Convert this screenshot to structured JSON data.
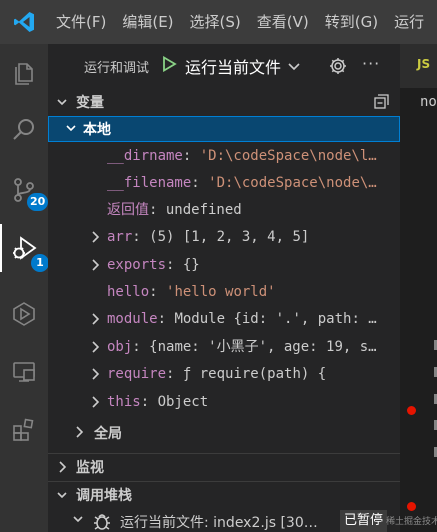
{
  "menu": [
    "文件(F)",
    "编辑(E)",
    "选择(S)",
    "查看(V)",
    "转到(G)",
    "运行"
  ],
  "activity_bar": {
    "items": [
      {
        "name": "explorer-icon"
      },
      {
        "name": "search-icon"
      },
      {
        "name": "source-control-icon",
        "badge": "20"
      },
      {
        "name": "run-debug-icon",
        "badge": "1",
        "active": true
      },
      {
        "name": "extensions-test-icon"
      },
      {
        "name": "remote-explorer-icon"
      },
      {
        "name": "extensions-icon"
      }
    ]
  },
  "debug_toolbar": {
    "title": "运行和调试",
    "config_label": "运行当前文件",
    "more_label": "···"
  },
  "sections": {
    "variables": "变量",
    "watch": "监视",
    "call_stack": "调用堆栈"
  },
  "scopes": {
    "local": "本地",
    "global": "全局"
  },
  "variables": [
    {
      "name": "__dirname",
      "value": "'D:\\codeSpace\\node\\l…",
      "kind": "string",
      "expandable": false
    },
    {
      "name": "__filename",
      "value": "'D:\\codeSpace\\node\\…",
      "kind": "string",
      "expandable": false
    },
    {
      "name": "返回值",
      "value": "undefined",
      "kind": "plain",
      "expandable": false,
      "label_is_text": true
    },
    {
      "name": "arr",
      "value": "(5) [1, 2, 3, 4, 5]",
      "kind": "plain",
      "expandable": true
    },
    {
      "name": "exports",
      "value": "{}",
      "kind": "plain",
      "expandable": true
    },
    {
      "name": "hello",
      "value": "'hello world'",
      "kind": "string",
      "expandable": false
    },
    {
      "name": "module",
      "value": "Module {id: '.', path: …",
      "kind": "plain",
      "expandable": true
    },
    {
      "name": "obj",
      "value": "{name: '小黑子', age: 19, s…",
      "kind": "plain",
      "expandable": true
    },
    {
      "name": "require",
      "value": "ƒ require(path) {",
      "kind": "plain",
      "expandable": true
    },
    {
      "name": "this",
      "value": "Object",
      "kind": "plain",
      "expandable": true
    }
  ],
  "call_stack": {
    "item_label": "运行当前文件: index2.js [30…",
    "status": "已暂停"
  },
  "editor": {
    "tab_icon_label": "JS",
    "visible_text": "no"
  },
  "watermark": "稀土掘金技术社区",
  "colors": {
    "accent": "#007acc",
    "selection": "#094771",
    "var_name": "#c586c0",
    "string": "#ce9178",
    "breakpoint": "#e51400"
  }
}
